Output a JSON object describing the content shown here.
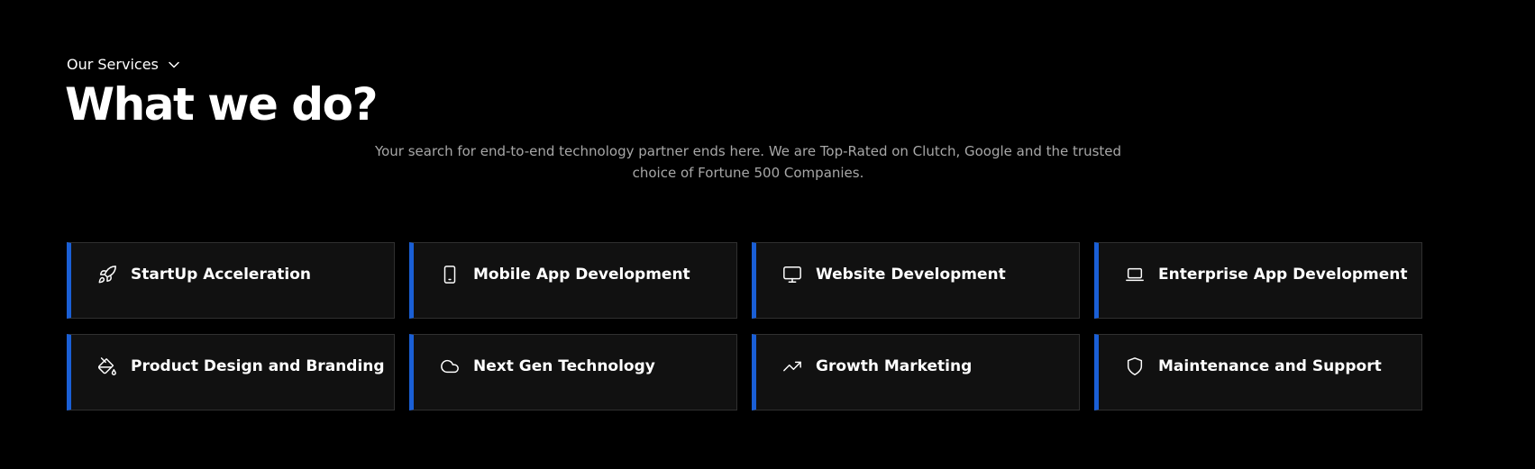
{
  "header": {
    "eyebrow": "Our Services",
    "title": "What we do?",
    "subtitle": "Your search for end-to-end technology partner ends here. We are Top-Rated on Clutch, Google and the trusted choice of Fortune 500 Companies."
  },
  "services": [
    {
      "label": "StartUp Acceleration",
      "icon": "rocket-icon"
    },
    {
      "label": "Mobile App Development",
      "icon": "smartphone-icon"
    },
    {
      "label": "Website Development",
      "icon": "monitor-icon"
    },
    {
      "label": "Enterprise App Development",
      "icon": "laptop-icon"
    },
    {
      "label": "Product Design and Branding",
      "icon": "paint-bucket-icon"
    },
    {
      "label": "Next Gen Technology",
      "icon": "cloud-icon"
    },
    {
      "label": "Growth Marketing",
      "icon": "trending-up-icon"
    },
    {
      "label": "Maintenance and Support",
      "icon": "shield-icon"
    }
  ],
  "colors": {
    "background": "#000000",
    "card_background": "#111111",
    "card_border": "#303030",
    "accent": "#1a5fd6",
    "subtitle": "#a7a7a7"
  }
}
